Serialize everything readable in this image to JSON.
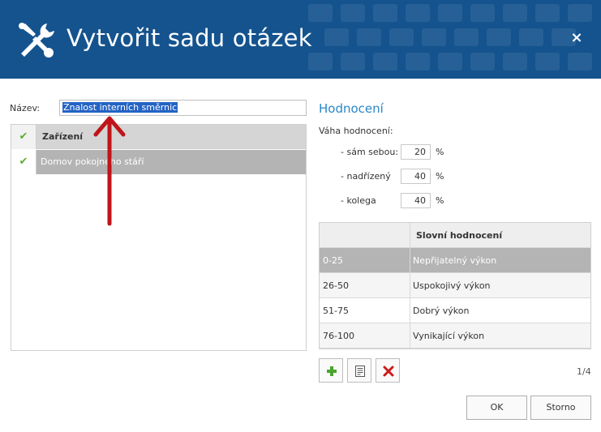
{
  "dialog": {
    "title": "Vytvořit sadu otázek",
    "close_label": "×",
    "colors": {
      "header": "#14538e",
      "accent": "#2a87c8",
      "selected_row": "#b4b4b4",
      "check": "#5fae2e",
      "delete": "#cc1b1b"
    }
  },
  "name_field": {
    "label": "Název:",
    "value": "Znalost interních směrnic"
  },
  "facilities": {
    "header_check": "✔",
    "column_header": "Zařízení",
    "rows": [
      {
        "check": "✔",
        "name": "Domov pokojného stáří"
      }
    ]
  },
  "evaluation": {
    "title": "Hodnocení",
    "weight_label": "Váha hodnocení:",
    "weights": [
      {
        "label": "- sám sebou:",
        "value": "20",
        "unit": "%"
      },
      {
        "label": "- nadřízený",
        "value": "40",
        "unit": "%"
      },
      {
        "label": "- kolega",
        "value": "40",
        "unit": "%"
      }
    ],
    "grid": {
      "headers": [
        "",
        "Slovní hodnocení"
      ],
      "rows": [
        {
          "range": "0-25",
          "text": "Nepřijatelný výkon"
        },
        {
          "range": "26-50",
          "text": "Uspokojivý výkon"
        },
        {
          "range": "51-75",
          "text": "Dobrý výkon"
        },
        {
          "range": "76-100",
          "text": "Vynikající výkon"
        }
      ]
    },
    "toolbar": {
      "add_icon": "plus-icon",
      "edit_icon": "document-icon",
      "delete_icon": "x-icon"
    },
    "pager": "1/4"
  },
  "footer": {
    "ok_label": "OK",
    "cancel_label": "Storno"
  }
}
